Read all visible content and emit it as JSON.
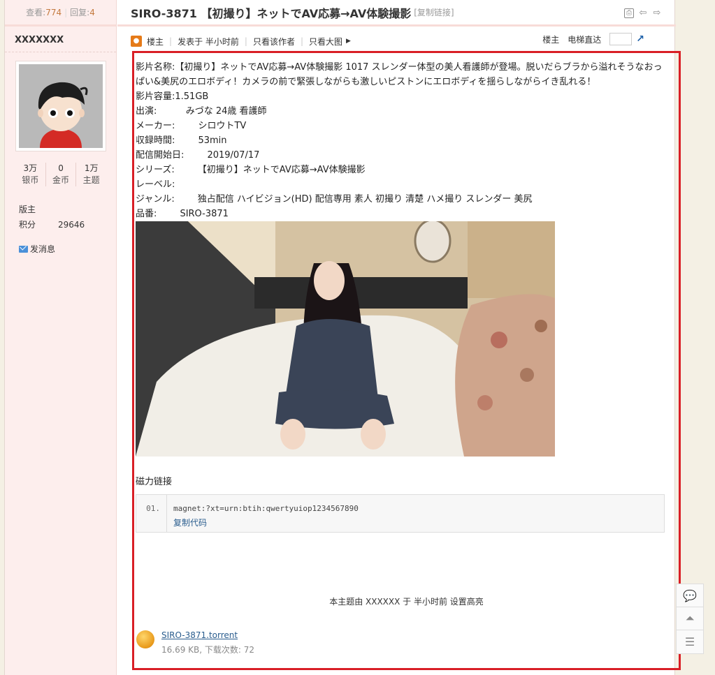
{
  "sidebar": {
    "views_label": "查看:",
    "views": "774",
    "replies_label": "回复:",
    "replies": "4",
    "username": "XXXXXXX",
    "stats": [
      {
        "value": "3万",
        "label": "银币"
      },
      {
        "value": "0",
        "label": "金币"
      },
      {
        "value": "1万",
        "label": "主题"
      }
    ],
    "role": "版主",
    "points_label": "积分",
    "points": "29646",
    "send_message": "发消息"
  },
  "thread": {
    "title": "SIRO-3871 【初撮り】ネットでAV応募→AV体験撮影",
    "copy_link": "[复制链接]"
  },
  "post_bar": {
    "owner": "楼主",
    "posted": "发表于 半小时前",
    "only_author": "只看该作者",
    "only_big_image": "只看大图",
    "owner_right": "楼主",
    "elevator": "电梯直达"
  },
  "info": {
    "name_label": "影片名称:",
    "name_value": "【初撮り】ネットでAV応募→AV体験撮影 1017 スレンダー体型の美人看護師が登場。脱いだらブラから溢れそうなおっぱい&美尻のエロボディ！カメラの前で緊張しながらも激しいピストンにエロボディを揺らしながらイき乱れる！",
    "size": "影片容量:1.51GB",
    "cast": "出演:          みづな 24歳 看護師",
    "maker": "メーカー:        シロウトTV",
    "duration": "収録時間:        53min",
    "release": "配信開始日:        2019/07/17",
    "series": "シリーズ:        【初撮り】ネットでAV応募→AV体験撮影",
    "label": "レーベル:",
    "genre": "ジャンル:        独占配信 ハイビジョン(HD) 配信専用 素人 初撮り 清楚 ハメ撮り スレンダー 美尻",
    "code": "品番:        SIRO-3871"
  },
  "magnet": {
    "title": "磁力链接",
    "line_no": "01.",
    "text": "magnet:?xt=urn:btih:qwertyuiop1234567890",
    "copy": "复制代码"
  },
  "highlight_note": "本主题由 XXXXXX 于 半小时前 设置高亮",
  "attachment": {
    "name": "SIRO-3871.torrent",
    "meta": "16.69 KB, 下载次数: 72"
  },
  "colors": {
    "accent_red": "#d91f26",
    "sidebar_bg": "#fdeeed",
    "link_blue": "#2a5d8e"
  }
}
